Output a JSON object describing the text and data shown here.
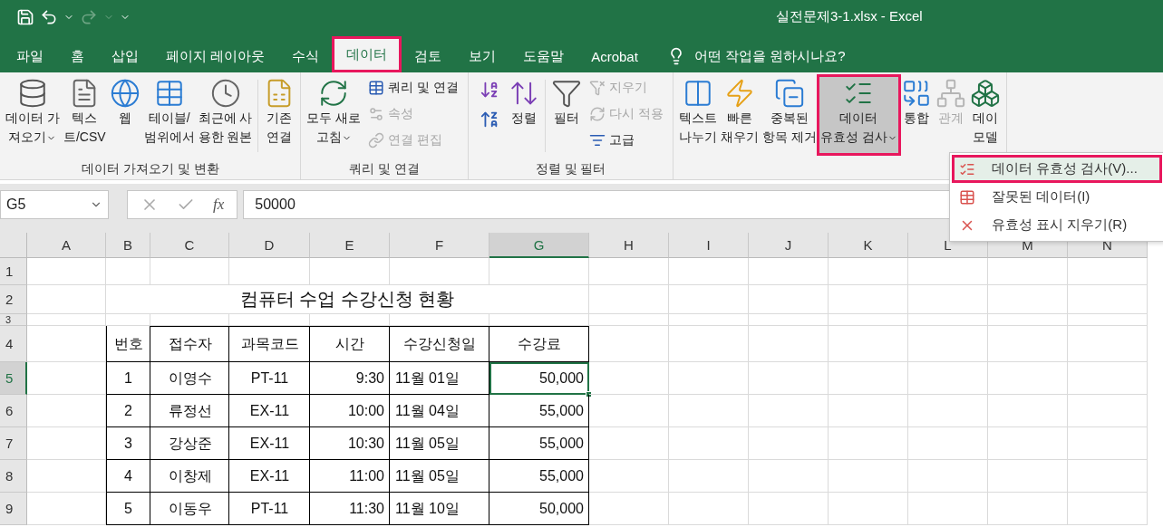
{
  "window": {
    "title": "실전문제3-1.xlsx - Excel"
  },
  "tabs": [
    {
      "label": "파일",
      "selected": false,
      "highlighted": false
    },
    {
      "label": "홈",
      "selected": false,
      "highlighted": false
    },
    {
      "label": "삽입",
      "selected": false,
      "highlighted": false
    },
    {
      "label": "페이지 레이아웃",
      "selected": false,
      "highlighted": false
    },
    {
      "label": "수식",
      "selected": false,
      "highlighted": false
    },
    {
      "label": "데이터",
      "selected": true,
      "highlighted": true
    },
    {
      "label": "검토",
      "selected": false,
      "highlighted": false
    },
    {
      "label": "보기",
      "selected": false,
      "highlighted": false
    },
    {
      "label": "도움말",
      "selected": false,
      "highlighted": false
    },
    {
      "label": "Acrobat",
      "selected": false,
      "highlighted": false
    }
  ],
  "tell_me": {
    "placeholder": "어떤 작업을 원하시나요?"
  },
  "ribbon_groups": [
    {
      "label": "데이터 가져오기 및 변환",
      "items": [
        {
          "kind": "large",
          "lines": [
            "데이터 가",
            "져오기"
          ],
          "dropdown": true,
          "disabled": false,
          "pressed": false,
          "highlighted": false
        },
        {
          "kind": "large",
          "lines": [
            "텍스",
            "트/CSV"
          ],
          "dropdown": false,
          "disabled": false,
          "pressed": false,
          "highlighted": false
        },
        {
          "kind": "large",
          "lines": [
            "웹"
          ],
          "dropdown": false,
          "disabled": false,
          "pressed": false,
          "highlighted": false
        },
        {
          "kind": "large",
          "lines": [
            "테이블/",
            "범위에서"
          ],
          "dropdown": false,
          "disabled": false,
          "pressed": false,
          "highlighted": false
        },
        {
          "kind": "large",
          "lines": [
            "최근에 사",
            "용한 원본"
          ],
          "dropdown": false,
          "disabled": false,
          "pressed": false,
          "highlighted": false
        },
        {
          "kind": "divider"
        },
        {
          "kind": "large",
          "lines": [
            "기존",
            "연결"
          ],
          "dropdown": false,
          "disabled": false,
          "pressed": false,
          "highlighted": false
        }
      ]
    },
    {
      "label": "쿼리 및 연결",
      "items": [
        {
          "kind": "large",
          "lines": [
            "모두 새로",
            "고침"
          ],
          "dropdown": true,
          "disabled": false,
          "pressed": false,
          "highlighted": false
        },
        {
          "kind": "stack",
          "items": [
            {
              "label": "쿼리 및 연결",
              "disabled": false
            },
            {
              "label": "속성",
              "disabled": true
            },
            {
              "label": "연결 편집",
              "disabled": true
            }
          ]
        }
      ]
    },
    {
      "label": "정렬 및 필터",
      "items": [
        {
          "kind": "sort_pair"
        },
        {
          "kind": "large",
          "lines": [
            "정렬"
          ],
          "dropdown": false,
          "disabled": false,
          "pressed": false,
          "highlighted": false
        },
        {
          "kind": "divider"
        },
        {
          "kind": "large",
          "lines": [
            "필터"
          ],
          "dropdown": false,
          "disabled": false,
          "pressed": false,
          "highlighted": false
        },
        {
          "kind": "stack",
          "items": [
            {
              "label": "지우기",
              "disabled": true
            },
            {
              "label": "다시 적용",
              "disabled": true
            },
            {
              "label": "고급",
              "disabled": false
            }
          ]
        }
      ]
    },
    {
      "items": [
        {
          "kind": "large",
          "lines": [
            "텍스트",
            "나누기"
          ],
          "dropdown": false,
          "disabled": false,
          "pressed": false,
          "highlighted": false
        },
        {
          "kind": "large",
          "lines": [
            "빠른",
            "채우기"
          ],
          "dropdown": false,
          "disabled": false,
          "pressed": false,
          "highlighted": false
        },
        {
          "kind": "large",
          "lines": [
            "중복된",
            "항목 제거"
          ],
          "dropdown": false,
          "disabled": false,
          "pressed": false,
          "highlighted": false
        },
        {
          "kind": "large",
          "lines": [
            "데이터",
            "유효성 검사"
          ],
          "dropdown": true,
          "disabled": false,
          "pressed": true,
          "highlighted": true
        },
        {
          "kind": "large",
          "lines": [
            "통합"
          ],
          "dropdown": false,
          "disabled": false,
          "pressed": false,
          "highlighted": false
        },
        {
          "kind": "large",
          "lines": [
            "관계"
          ],
          "dropdown": false,
          "disabled": true,
          "pressed": false,
          "highlighted": false
        },
        {
          "kind": "large",
          "lines": [
            "데이",
            "모델"
          ],
          "dropdown": false,
          "disabled": false,
          "pressed": false,
          "highlighted": false
        }
      ]
    }
  ],
  "dropdown_menu": [
    {
      "label": "데이터 유효성 검사(V)...",
      "highlighted": true
    },
    {
      "label": "잘못된 데이터(I)",
      "highlighted": false
    },
    {
      "label": "유효성 표시 지우기(R)",
      "highlighted": false
    }
  ],
  "formula_bar": {
    "name_box": "G5",
    "function_label": "fx",
    "value": "50000"
  },
  "sheet": {
    "columns": [
      {
        "label": "A",
        "selected": false
      },
      {
        "label": "B",
        "selected": false
      },
      {
        "label": "C",
        "selected": false
      },
      {
        "label": "D",
        "selected": false
      },
      {
        "label": "E",
        "selected": false
      },
      {
        "label": "F",
        "selected": false
      },
      {
        "label": "G",
        "selected": true
      },
      {
        "label": "H",
        "selected": false
      },
      {
        "label": "I",
        "selected": false
      },
      {
        "label": "J",
        "selected": false
      },
      {
        "label": "K",
        "selected": false
      },
      {
        "label": "L",
        "selected": false
      },
      {
        "label": "M",
        "selected": false
      },
      {
        "label": "N",
        "selected": false
      }
    ],
    "rows": [
      {
        "label": "1",
        "selected": false
      },
      {
        "label": "2",
        "selected": false
      },
      {
        "label": "3",
        "selected": false
      },
      {
        "label": "4",
        "selected": false
      },
      {
        "label": "5",
        "selected": true
      },
      {
        "label": "6",
        "selected": false
      },
      {
        "label": "7",
        "selected": false
      },
      {
        "label": "8",
        "selected": false
      },
      {
        "label": "9",
        "selected": false
      }
    ],
    "title": "컴퓨터 수업 수강신청 현황",
    "table_header": [
      "번호",
      "접수자",
      "과목코드",
      "시간",
      "수강신청일",
      "수강료"
    ],
    "table_rows": [
      [
        "1",
        "이영수",
        "PT-11",
        "9:30",
        "11월 01일",
        "50,000"
      ],
      [
        "2",
        "류정선",
        "EX-11",
        "10:00",
        "11월 04일",
        "55,000"
      ],
      [
        "3",
        "강상준",
        "EX-11",
        "10:30",
        "11월 05일",
        "55,000"
      ],
      [
        "4",
        "이창제",
        "EX-11",
        "11:00",
        "11월 05일",
        "55,000"
      ],
      [
        "5",
        "이동우",
        "PT-11",
        "11:30",
        "11월 10일",
        "50,000"
      ]
    ]
  }
}
